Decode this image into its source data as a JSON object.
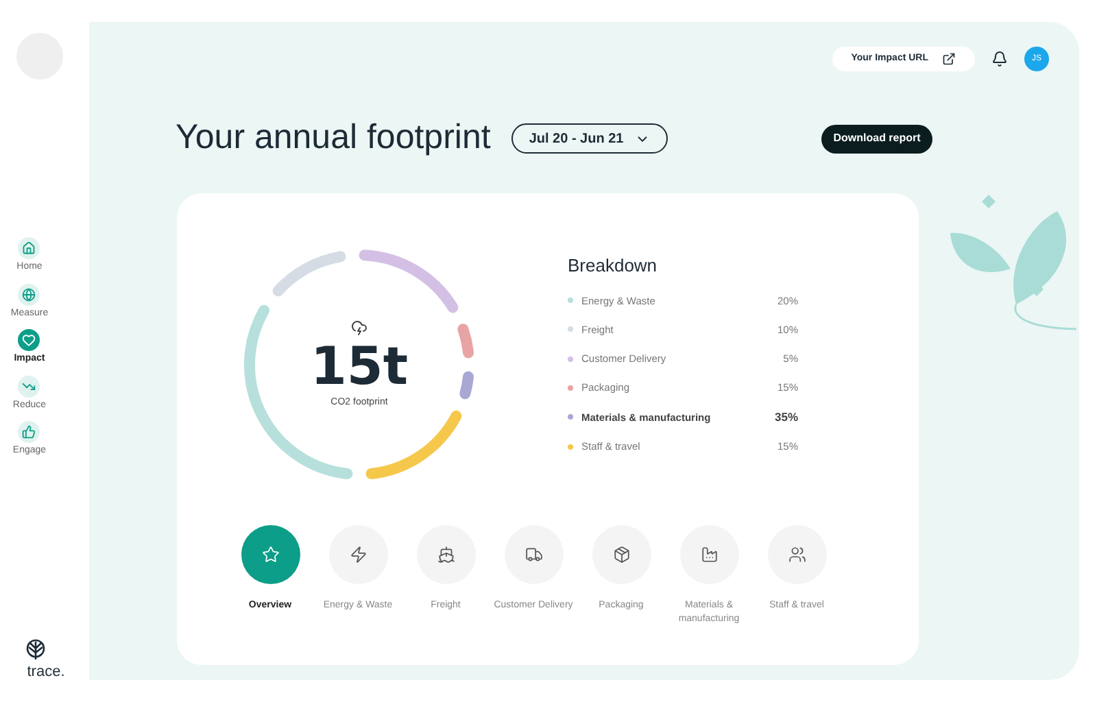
{
  "sidebar": {
    "items": [
      {
        "label": "Home",
        "selected": false
      },
      {
        "label": "Measure",
        "selected": false
      },
      {
        "label": "Impact",
        "selected": true
      },
      {
        "label": "Reduce",
        "selected": false
      },
      {
        "label": "Engage",
        "selected": false
      }
    ],
    "logo": "trace."
  },
  "topbar": {
    "impact_url": "Your Impact URL",
    "avatar": "JS"
  },
  "header": {
    "title": "Your annual footprint",
    "period": "Jul 20 - Jun 21",
    "download": "Download report"
  },
  "summary": {
    "value": "15t",
    "caption": "CO2 footprint"
  },
  "breakdown": {
    "title": "Breakdown",
    "items": [
      {
        "label": "Energy & Waste",
        "percent": "20%",
        "color": "#b7e0dd",
        "selected": false
      },
      {
        "label": "Freight",
        "percent": "10%",
        "color": "#d5dce4",
        "selected": false
      },
      {
        "label": "Customer Delivery",
        "percent": "5%",
        "color": "#d4c0e4",
        "selected": false
      },
      {
        "label": "Packaging",
        "percent": "15%",
        "color": "#e8a4a4",
        "selected": false
      },
      {
        "label": "Materials & manufacturing",
        "percent": "35%",
        "color": "#a9a8d4",
        "selected": true
      },
      {
        "label": "Staff & travel",
        "percent": "15%",
        "color": "#f5c84c",
        "selected": false
      }
    ]
  },
  "categories": [
    {
      "label": "Overview",
      "selected": true
    },
    {
      "label": "Energy & Waste",
      "selected": false
    },
    {
      "label": "Freight",
      "selected": false
    },
    {
      "label": "Customer Delivery",
      "selected": false
    },
    {
      "label": "Packaging",
      "selected": false
    },
    {
      "label": "Materials & manufacturing",
      "selected": false
    },
    {
      "label": "Staff & travel",
      "selected": false
    }
  ]
}
